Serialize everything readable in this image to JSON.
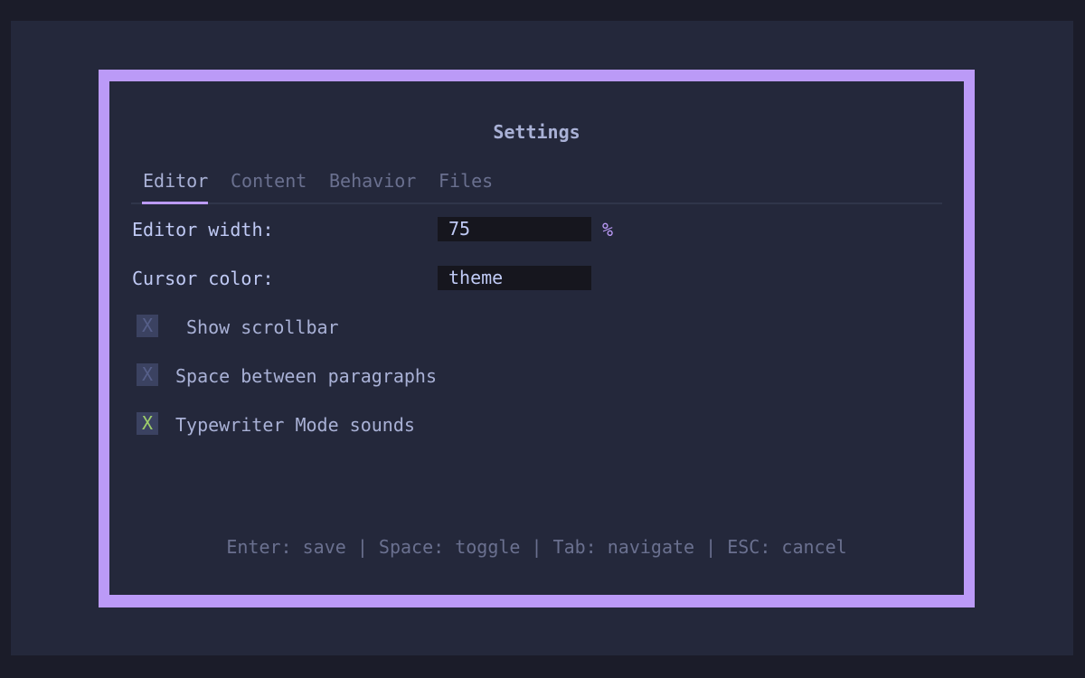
{
  "dialog": {
    "title": "Settings",
    "tabs": [
      {
        "label": "Editor",
        "active": true
      },
      {
        "label": "Content",
        "active": false
      },
      {
        "label": "Behavior",
        "active": false
      },
      {
        "label": "Files",
        "active": false
      }
    ],
    "fields": {
      "editor_width": {
        "label": "Editor width:",
        "value": "75",
        "unit": "%"
      },
      "cursor_color": {
        "label": "Cursor color:",
        "value": "theme"
      }
    },
    "checkboxes": [
      {
        "mark": "X",
        "label": "Show scrollbar",
        "checked": false
      },
      {
        "mark": "X",
        "label": "Space between paragraphs",
        "checked": false
      },
      {
        "mark": "X",
        "label": "Typewriter Mode sounds",
        "checked": true
      }
    ],
    "help_text": "Enter: save | Space: toggle | Tab: navigate | ESC: cancel"
  },
  "colors": {
    "accent": "#bb9af7",
    "background": "#24283b",
    "outer_background": "#1b1c29",
    "input_background": "#16161e",
    "checkbox_background": "#3b4261",
    "checked_mark": "#9ece6a",
    "unchecked_mark": "#565f89",
    "muted_text": "#6a708f",
    "text": "#c0caf5"
  }
}
